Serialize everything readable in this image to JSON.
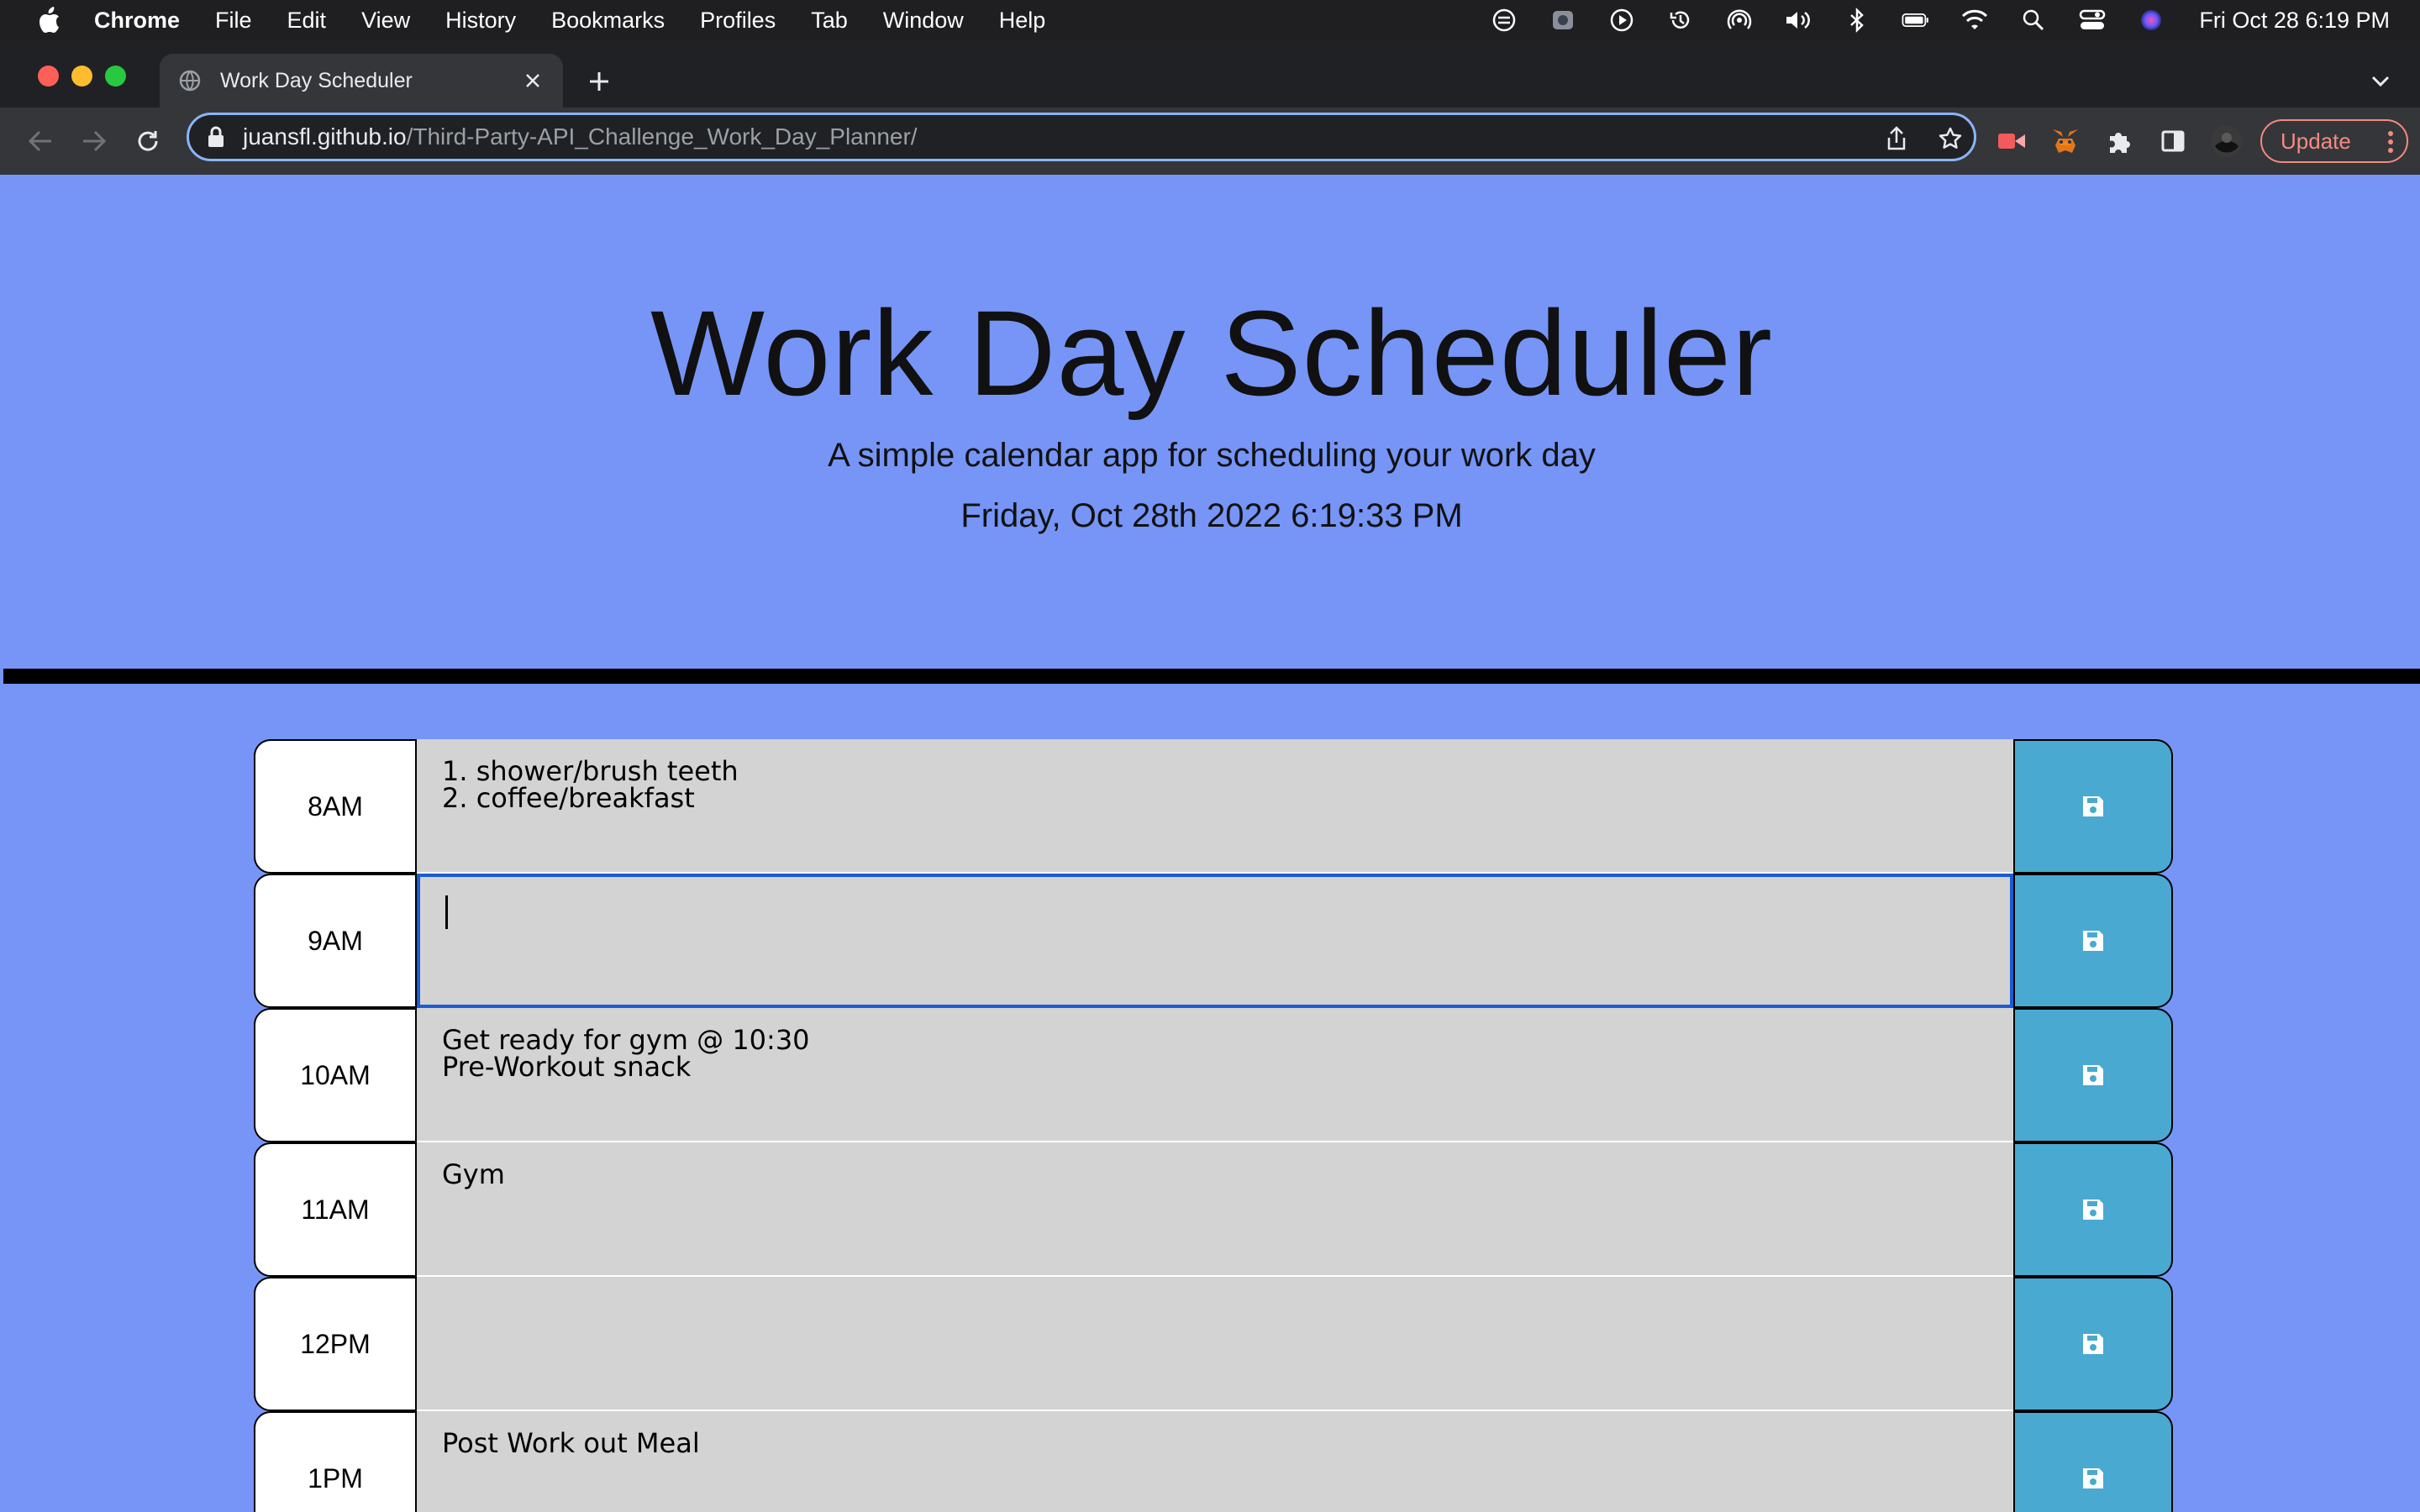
{
  "menubar": {
    "app_name": "Chrome",
    "items": [
      "File",
      "Edit",
      "View",
      "History",
      "Bookmarks",
      "Profiles",
      "Tab",
      "Window",
      "Help"
    ],
    "clock": "Fri Oct 28  6:19 PM"
  },
  "browser": {
    "tab_title": "Work Day Scheduler",
    "url_domain": "juansfl.github.io",
    "url_path": "/Third-Party-API_Challenge_Work_Day_Planner/",
    "update_label": "Update"
  },
  "header": {
    "title": "Work Day Scheduler",
    "lead": "A simple calendar app for scheduling your work day",
    "current_day": "Friday, Oct 28th 2022 6:19:33 PM"
  },
  "schedule": [
    {
      "hour": "8AM",
      "text": "1. shower/brush teeth\n2. coffee/breakfast"
    },
    {
      "hour": "9AM",
      "text": ""
    },
    {
      "hour": "10AM",
      "text": "Get ready for gym @ 10:30\nPre-Workout snack"
    },
    {
      "hour": "11AM",
      "text": "Gym"
    },
    {
      "hour": "12PM",
      "text": ""
    },
    {
      "hour": "1PM",
      "text": "Post Work out Meal"
    }
  ],
  "colors": {
    "page_bg": "#7695f7",
    "textarea_bg": "#d3d3d3",
    "save_button": "#4aa9d1",
    "focus_border": "#1a5bd6"
  }
}
